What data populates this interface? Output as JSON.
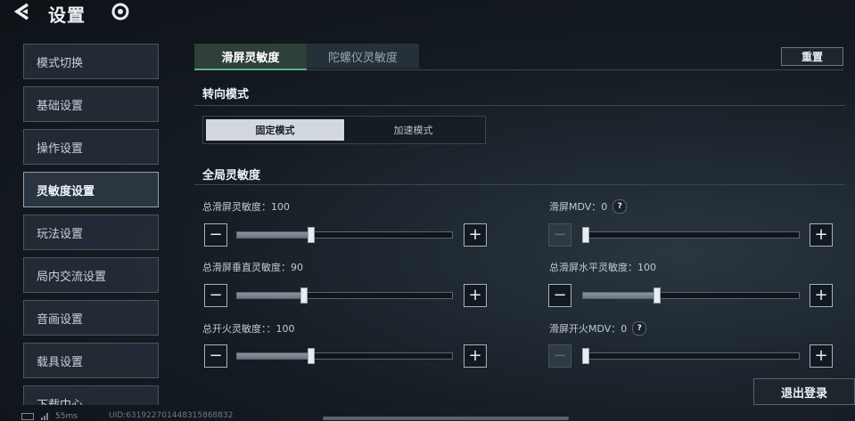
{
  "header": {
    "title": "设置",
    "back_icon": "back-arrow-icon",
    "logo_icon": "game-logo-icon"
  },
  "sidebar": {
    "items": [
      {
        "label": "模式切换",
        "active": false
      },
      {
        "label": "基础设置",
        "active": false
      },
      {
        "label": "操作设置",
        "active": false
      },
      {
        "label": "灵敏度设置",
        "active": true
      },
      {
        "label": "玩法设置",
        "active": false
      },
      {
        "label": "局内交流设置",
        "active": false
      },
      {
        "label": "音画设置",
        "active": false
      },
      {
        "label": "载具设置",
        "active": false
      },
      {
        "label": "下载中心",
        "active": false
      }
    ]
  },
  "tabs": [
    {
      "label": "滑屏灵敏度",
      "active": true
    },
    {
      "label": "陀螺仪灵敏度",
      "active": false
    }
  ],
  "reset_label": "重置",
  "steering": {
    "title": "转向模式",
    "options": [
      {
        "label": "固定模式",
        "selected": true
      },
      {
        "label": "加速模式",
        "selected": false
      }
    ]
  },
  "global": {
    "title": "全局灵敏度",
    "sliders": [
      {
        "label": "总滑屏灵敏度：100",
        "value": 100,
        "fraction": 0.33,
        "enabled": true
      },
      {
        "label": "滑屏MDV：0",
        "value": 0,
        "fraction": 0.0,
        "enabled": true,
        "minus_disabled": true,
        "has_help": true
      },
      {
        "label": "总滑屏垂直灵敏度：90",
        "value": 90,
        "fraction": 0.3,
        "enabled": true
      },
      {
        "label": "总滑屏水平灵敏度：100",
        "value": 100,
        "fraction": 0.33,
        "enabled": true
      },
      {
        "label": "总开火灵敏度：：100",
        "value": 100,
        "fraction": 0.33,
        "enabled": true
      },
      {
        "label": "滑屏开火MDV：0",
        "value": 0,
        "fraction": 0.0,
        "enabled": true,
        "minus_disabled": true,
        "has_help": true
      }
    ]
  },
  "logout_label": "退出登录",
  "status": {
    "latency": "55ms",
    "uid": "UID:631922701448315868832"
  }
}
